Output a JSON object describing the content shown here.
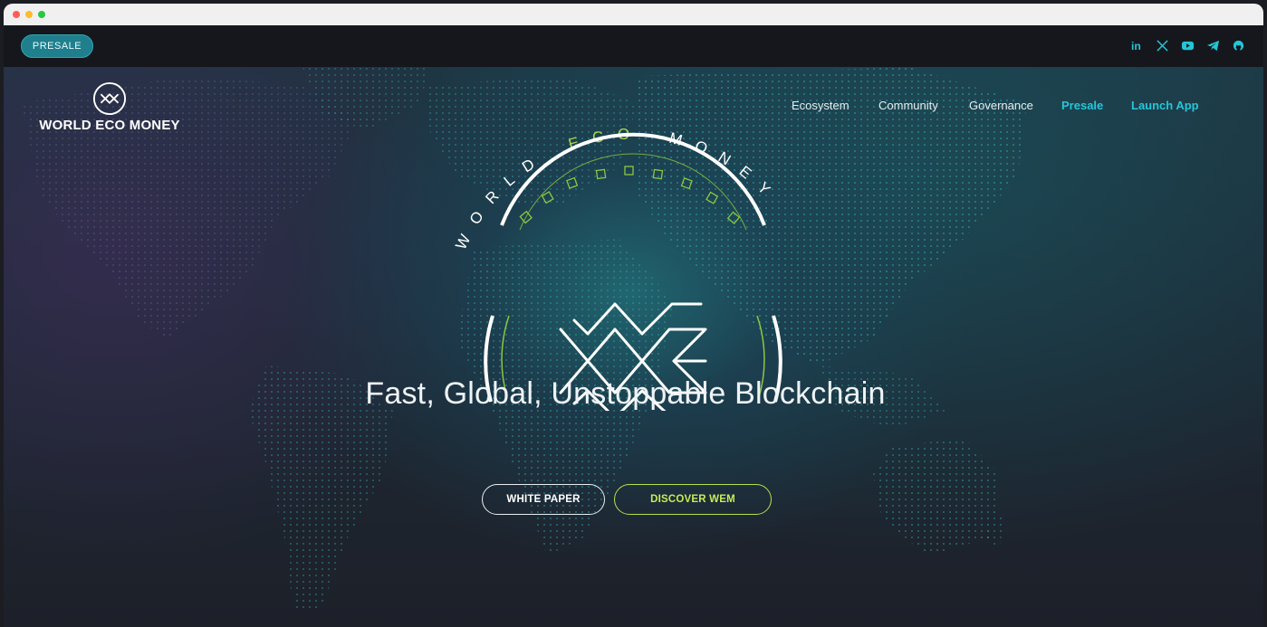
{
  "topbar": {
    "presale_label": "PRESALE",
    "socials": [
      {
        "icon": "linkedin-icon",
        "label": "in"
      },
      {
        "icon": "x-icon",
        "label": "𝕏"
      },
      {
        "icon": "youtube-icon"
      },
      {
        "icon": "telegram-icon"
      },
      {
        "icon": "github-icon"
      }
    ]
  },
  "brand": {
    "name": "WORLD ECO MONEY"
  },
  "nav": {
    "items": [
      {
        "label": "Ecosystem"
      },
      {
        "label": "Community"
      },
      {
        "label": "Governance"
      },
      {
        "label": "Presale"
      },
      {
        "label": "Launch App"
      }
    ]
  },
  "emblem": {
    "arc_word_1": "WORLD",
    "arc_word_2": "ECO",
    "arc_word_3": "MONEY"
  },
  "hero": {
    "headline": "Fast, Global, Unstoppable Blockchain",
    "cta_primary": "WHITE PAPER",
    "cta_secondary": "DISCOVER WEM"
  },
  "colors": {
    "accent_cyan": "#25c6d9",
    "accent_green": "#b7e04a",
    "presale_pill": "#1f7f8c",
    "topbar_bg": "#15171c"
  }
}
